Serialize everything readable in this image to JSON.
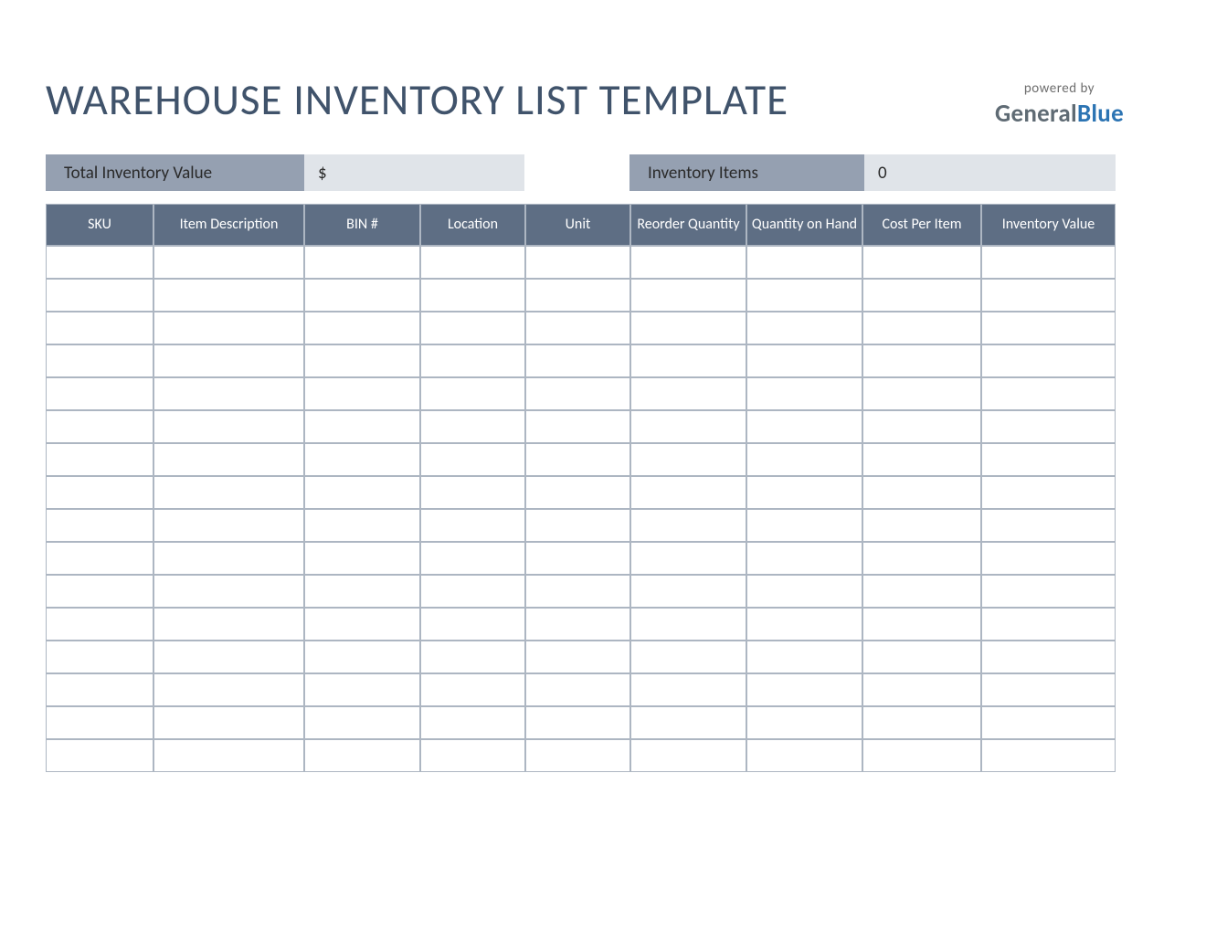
{
  "title": "WAREHOUSE INVENTORY LIST TEMPLATE",
  "brand": {
    "powered": "powered by",
    "name1": "General",
    "name2": "Blue"
  },
  "summary": {
    "total_label": "Total Inventory Value",
    "total_value": "$",
    "items_label": "Inventory Items",
    "items_value": "0"
  },
  "columns": [
    "SKU",
    "Item Description",
    "BIN #",
    "Location",
    "Unit",
    "Reorder Quantity",
    "Quantity on Hand",
    "Cost Per Item",
    "Inventory Value"
  ],
  "rows": [
    [
      "",
      "",
      "",
      "",
      "",
      "",
      "",
      "",
      ""
    ],
    [
      "",
      "",
      "",
      "",
      "",
      "",
      "",
      "",
      ""
    ],
    [
      "",
      "",
      "",
      "",
      "",
      "",
      "",
      "",
      ""
    ],
    [
      "",
      "",
      "",
      "",
      "",
      "",
      "",
      "",
      ""
    ],
    [
      "",
      "",
      "",
      "",
      "",
      "",
      "",
      "",
      ""
    ],
    [
      "",
      "",
      "",
      "",
      "",
      "",
      "",
      "",
      ""
    ],
    [
      "",
      "",
      "",
      "",
      "",
      "",
      "",
      "",
      ""
    ],
    [
      "",
      "",
      "",
      "",
      "",
      "",
      "",
      "",
      ""
    ],
    [
      "",
      "",
      "",
      "",
      "",
      "",
      "",
      "",
      ""
    ],
    [
      "",
      "",
      "",
      "",
      "",
      "",
      "",
      "",
      ""
    ],
    [
      "",
      "",
      "",
      "",
      "",
      "",
      "",
      "",
      ""
    ],
    [
      "",
      "",
      "",
      "",
      "",
      "",
      "",
      "",
      ""
    ],
    [
      "",
      "",
      "",
      "",
      "",
      "",
      "",
      "",
      ""
    ],
    [
      "",
      "",
      "",
      "",
      "",
      "",
      "",
      "",
      ""
    ],
    [
      "",
      "",
      "",
      "",
      "",
      "",
      "",
      "",
      ""
    ],
    [
      "",
      "",
      "",
      "",
      "",
      "",
      "",
      "",
      ""
    ]
  ]
}
